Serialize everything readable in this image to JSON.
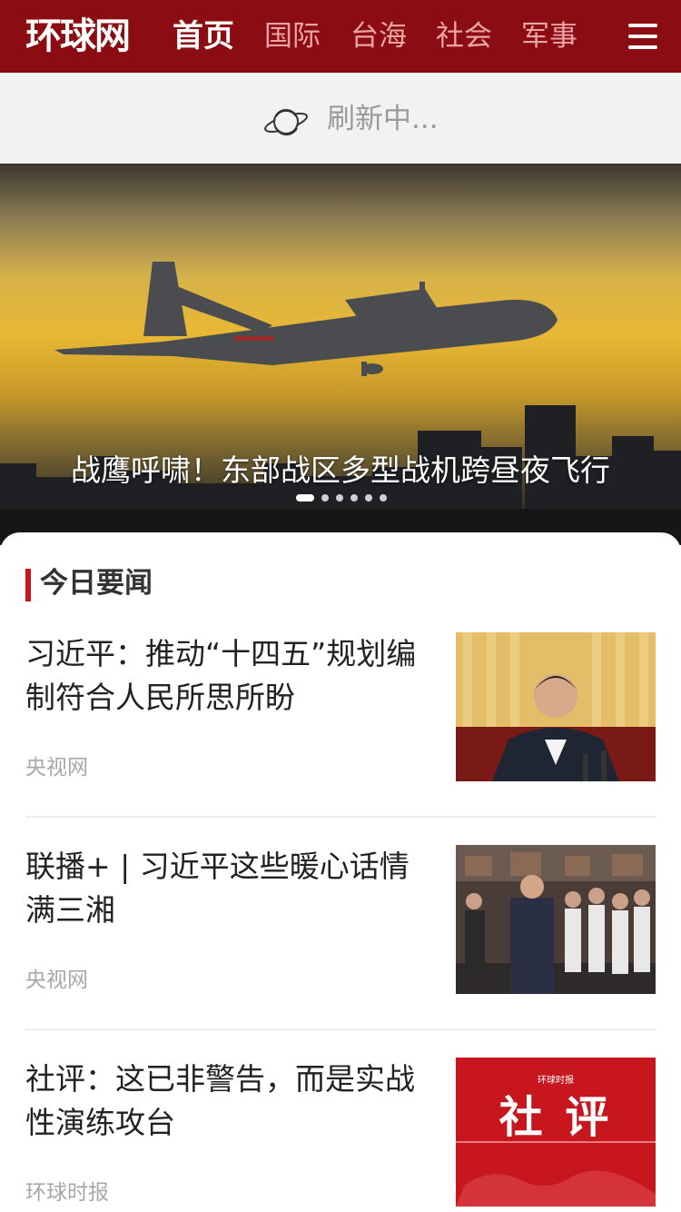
{
  "header": {
    "logo_text": "环球网",
    "tabs": [
      "首页",
      "国际",
      "台海",
      "社会",
      "军事"
    ],
    "active_tab": 0,
    "menu_icon": "hamburger-menu-icon"
  },
  "refresh": {
    "icon": "planet-icon",
    "text": "刷新中..."
  },
  "hero": {
    "caption": "战鹰呼啸！东部战区多型战机跨昼夜飞行",
    "slide_count": 6,
    "active_slide": 0
  },
  "section": {
    "title": "今日要闻"
  },
  "news": [
    {
      "title": "习近平：推动“十四五”规划编制符合人民所思所盼",
      "source": "央视网"
    },
    {
      "title": "联播+ | 习近平这些暖心话情满三湘",
      "source": "央视网"
    },
    {
      "title": "社评：这已非警告，而是实战性演练攻台",
      "source": "环球时报",
      "thumb_text": "社 评",
      "thumb_logo": "环球时报"
    }
  ],
  "colors": {
    "brand_red": "#8b0c12",
    "accent_red": "#c8161e",
    "inactive_tab": "#e9a4a6"
  }
}
